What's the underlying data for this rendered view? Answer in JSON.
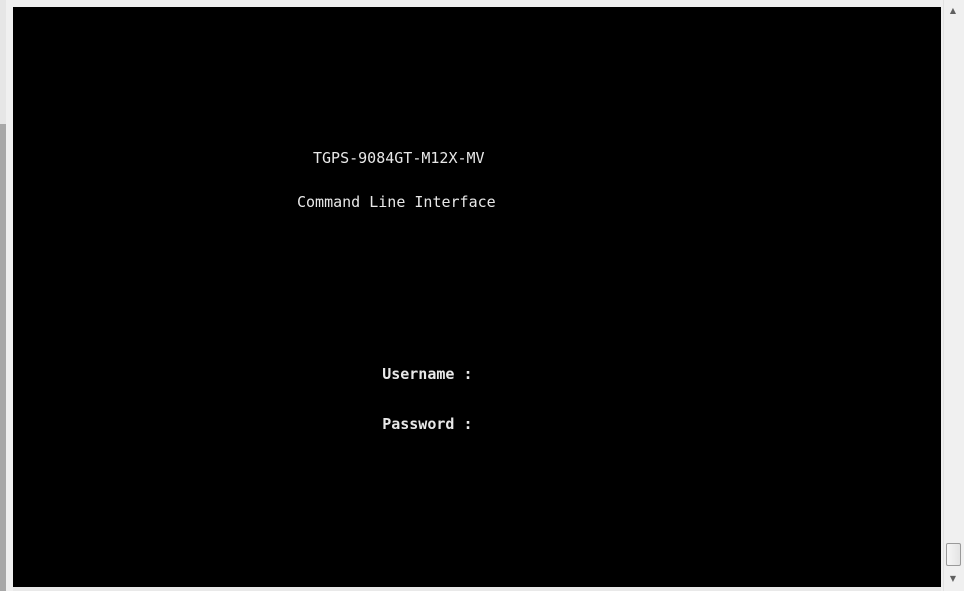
{
  "terminal": {
    "title": "TGPS-9084GT-M12X-MV",
    "subtitle": "Command Line Interface",
    "username_label": "Username :",
    "password_label": "Password :",
    "username_value": "",
    "password_value": ""
  },
  "scrollbar": {
    "up_icon": "chevron-up",
    "down_icon": "chevron-down",
    "position": 1.0
  },
  "colors": {
    "terminal_background": "#000000",
    "terminal_text": "#e8e8e8",
    "window_chrome": "#f0f0f0"
  }
}
